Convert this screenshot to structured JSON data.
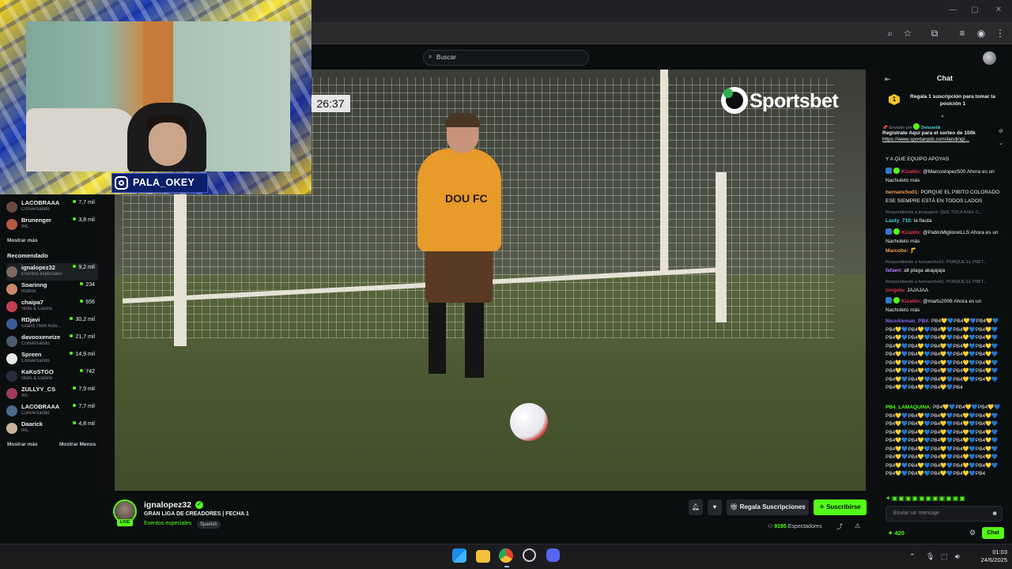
{
  "search": {
    "placeholder": "Buscar"
  },
  "sidebar": {
    "followed": [
      {
        "name": "LACOBRAAA",
        "category": "Conversando",
        "viewers": "7,7 mil",
        "color": "#6b4a3a"
      },
      {
        "name": "Brunenger",
        "category": "IRL",
        "viewers": "3,8 mil",
        "color": "#b35a45"
      }
    ],
    "show_more": "Mostrar más",
    "recommended_header": "Recomendado",
    "recommended": [
      {
        "name": "ignalopez32",
        "category": "Eventos especiales",
        "viewers": "9,2 mil",
        "color": "#7d6a5a"
      },
      {
        "name": "Soarinng",
        "category": "Roblox",
        "viewers": "234",
        "color": "#c98a6a"
      },
      {
        "name": "chaipa7",
        "category": "Slots & Casino",
        "viewers": "656",
        "color": "#c04050"
      },
      {
        "name": "RDjavi",
        "category": "Grand Theft Auto...",
        "viewers": "30,2 mil",
        "color": "#3a5a9a"
      },
      {
        "name": "davooxeneize",
        "category": "Conversando",
        "viewers": "21,7 mil",
        "color": "#4a5a6a"
      },
      {
        "name": "Spreen",
        "category": "Conversando",
        "viewers": "14,9 mil",
        "color": "#e8e8e8"
      },
      {
        "name": "KaKoSTGO",
        "category": "Slots & Casino",
        "viewers": "742",
        "color": "#2a2a3a"
      },
      {
        "name": "ZULLYY_CS",
        "category": "IRL",
        "viewers": "7,9 mil",
        "color": "#a03a5a"
      },
      {
        "name": "LACOBRAAA",
        "category": "Conversando",
        "viewers": "7,7 mil",
        "color": "#4a6a8a"
      },
      {
        "name": "Daarick",
        "category": "IRL",
        "viewers": "4,8 mil",
        "color": "#c8b49a"
      }
    ],
    "show_more_bottom": "Mostrar más",
    "show_less": "Mostrar Menos"
  },
  "overlay": {
    "instagram_handle": "PALA_OKEY"
  },
  "video": {
    "timer": "26:37",
    "sponsor": "Sportsbet",
    "jersey": "DOU FC"
  },
  "chat": {
    "title": "Chat",
    "gift_badge": "1",
    "gift_text": "Regala 1 suscripción para tomar la posición 1",
    "pinned_by": "Enviado por",
    "pinned_user": "Deluxebk",
    "pinned_text": "Registrate Aquí para el sorteo de 100k",
    "pinned_link": "https://www.sportargsb.com/landing/...",
    "messages": [
      {
        "user": "",
        "text": "Y A QUE EQUIPO APOYAS",
        "user_color": "#efeff1"
      },
      {
        "user": "Kizaldo:",
        "text": "@Marcoslopez500 Ahora es un Nacholeto más",
        "user_color": "#e0324a"
      },
      {
        "user": "hernancho01:",
        "text": "PORQUE EL PIBITO COLORADO ESE SIEMPRE ESTÁ EN TODOS LADOS",
        "user_color": "#f0a050"
      },
      {
        "user": "Lauty_710:",
        "text": "la flauta",
        "user_color": "#4bd0d8",
        "reply": "Respondiendo a jeropajero: QUE TOCA AXEL C..."
      },
      {
        "user": "Kizaldo:",
        "text": "@PabloMigliorelLLS Ahora es un Nacholeto más",
        "user_color": "#e0324a"
      },
      {
        "user": "Marcobe:",
        "text": "🦵",
        "user_color": "#f0a050"
      },
      {
        "user": "fafaen:",
        "text": "alt plaga akajajaja",
        "user_color": "#b07af0",
        "reply": "Respondiendo a hernancho01: PORQUE EL PIBIT..."
      },
      {
        "user": "zorgola:",
        "text": "JAJAJAA",
        "user_color": "#e0324a",
        "reply": "Respondiendo a hernancho01: PORQUE EL PIBIT..."
      },
      {
        "user": "Kizaldo:",
        "text": "@martu2008 Ahora es un Nacholeto más",
        "user_color": "#e0324a"
      },
      {
        "user": "NicoAleman_PB4:",
        "text": "PB4💛💙PB4💛💙PB4💛💙PB4💛💙PB4💛💙PB4💛💙PB4💛💙PB4💛💙PB4💛💙PB4💛💙PB4💛💙PB4💛💙PB4💛💙PB4💛💙PB4💛💙PB4💛💙PB4💛💙PB4💛💙PB4💛💙PB4💛💙PB4💛💙PB4💛💙PB4💛💙PB4💛💙PB4💛💙PB4💛💙PB4💛💙PB4💛💙PB4💛💙PB4💛💙PB4💛💙PB4💛💙PB4💛💙PB4💛💙PB4💛💙PB4💛💙PB4💛💙PB4💛💙PB4💛💙PB4💛💙PB4💛💙PB4",
        "user_color": "#8a6af0"
      },
      {
        "user": "PB4_LAMAQUINA:",
        "text": "PB4💛💙PB4💛💙PB4💛💙PB4💛💙PB4💛💙PB4💛💙PB4💛💙PB4💛💙PB4💛💙PB4💛💙PB4💛💙PB4💛💙PB4💛💙PB4💛💙PB4💛💙PB4💛💙PB4💛💙PB4💛💙PB4💛💙PB4💛💙PB4💛💙PB4💛💙PB4💛💙PB4💛💙PB4💛💙PB4💛💙PB4💛💙PB4💛💙PB4💛💙PB4💛💙PB4💛💙PB4💛💙PB4💛💙PB4💛💙PB4💛💙PB4💛💙PB4💛💙PB4💛💙PB4💛💙PB4💛💙PB4💛💙PB4💛💙PB4",
        "user_color": "#53fc18"
      }
    ],
    "input_placeholder": "Enviar un mensaje",
    "points": "420",
    "send_label": "Chat"
  },
  "stream": {
    "streamer": "ignalopez32",
    "live": "LIVE",
    "title": "GRAN LIGA DE CREADORES | FECHA 1",
    "category": "Eventos especiales",
    "tag": "Spanish",
    "gift_subs_label": "Regala Suscripciones",
    "subscribe_label": "Suscribirse",
    "viewers_count": "9195",
    "viewers_label": "Espectadores"
  },
  "taskbar": {
    "time": "01:03",
    "date": "24/6/2025"
  },
  "colors": {
    "kick_green": "#53fc18",
    "background": "#0b0e0f"
  }
}
